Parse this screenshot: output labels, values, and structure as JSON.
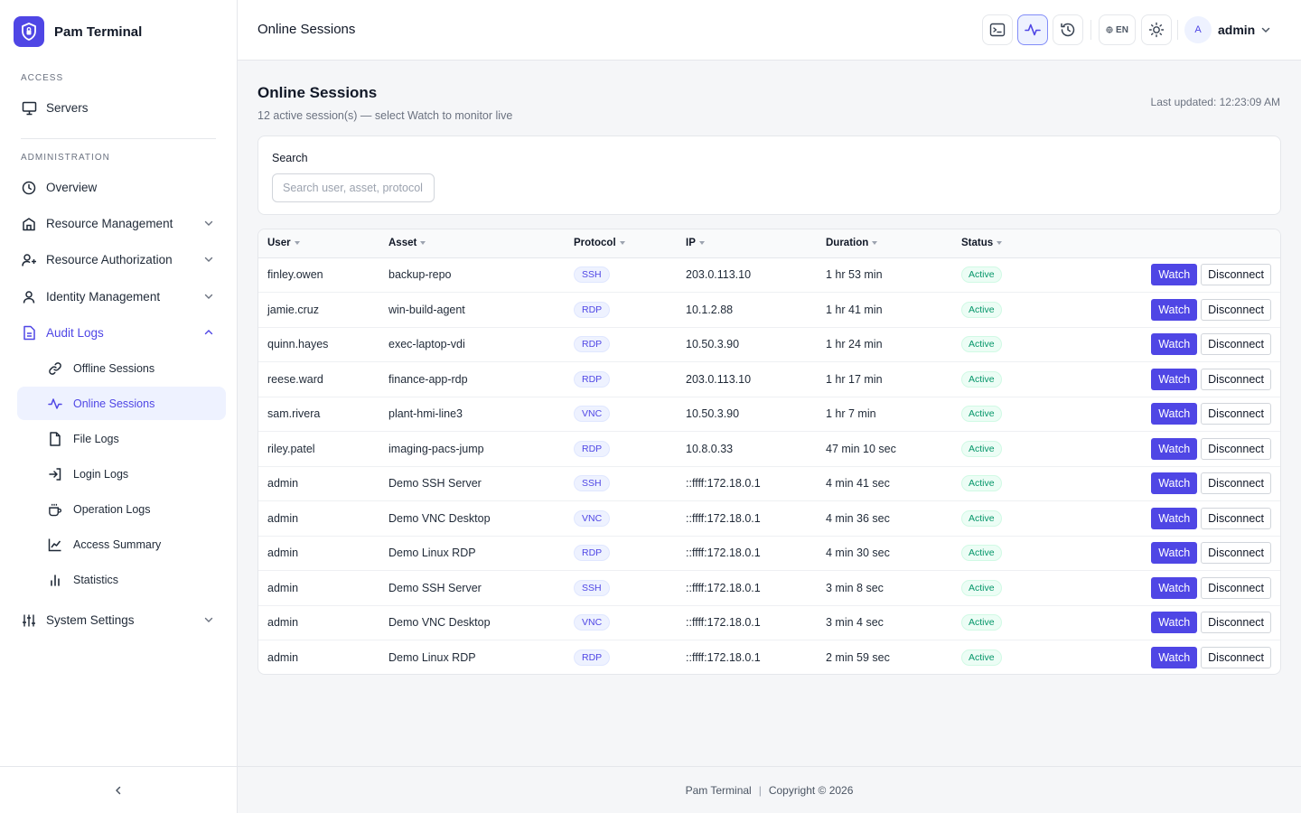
{
  "app": {
    "name": "Pam Terminal",
    "logo_icon": "shield-lock-icon",
    "accent_color": "#4f46e5"
  },
  "sidebar": {
    "sections": {
      "access": "ACCESS",
      "administration": "ADMINISTRATION"
    },
    "items": {
      "servers": "Servers",
      "overview": "Overview",
      "resource_management": "Resource Management",
      "resource_authorization": "Resource Authorization",
      "identity_management": "Identity Management",
      "audit_logs": "Audit Logs",
      "offline_sessions": "Offline Sessions",
      "online_sessions": "Online Sessions",
      "file_logs": "File Logs",
      "login_logs": "Login Logs",
      "operation_logs": "Operation Logs",
      "access_summary": "Access Summary",
      "statistics": "Statistics",
      "system_settings": "System Settings"
    },
    "active_item": "Online Sessions"
  },
  "header": {
    "title": "Online Sessions",
    "language": "EN",
    "user": {
      "avatar_initial": "A",
      "name": "admin"
    }
  },
  "main": {
    "title": "Online Sessions",
    "subtitle": "12 active session(s) — select Watch to monitor live",
    "last_updated": "Last updated: 12:23:09 AM",
    "search": {
      "label": "Search",
      "placeholder": "Search user, asset, protocol",
      "value": ""
    },
    "table": {
      "columns": {
        "user": "User",
        "asset": "Asset",
        "protocol": "Protocol",
        "ip": "IP",
        "duration": "Duration",
        "status": "Status"
      },
      "actions": {
        "watch": "Watch",
        "disconnect": "Disconnect"
      },
      "rows": [
        {
          "user": "finley.owen",
          "asset": "backup-repo",
          "protocol": "SSH",
          "ip": "203.0.113.10",
          "duration": "1 hr 53 min",
          "status": "Active"
        },
        {
          "user": "jamie.cruz",
          "asset": "win-build-agent",
          "protocol": "RDP",
          "ip": "10.1.2.88",
          "duration": "1 hr 41 min",
          "status": "Active"
        },
        {
          "user": "quinn.hayes",
          "asset": "exec-laptop-vdi",
          "protocol": "RDP",
          "ip": "10.50.3.90",
          "duration": "1 hr 24 min",
          "status": "Active"
        },
        {
          "user": "reese.ward",
          "asset": "finance-app-rdp",
          "protocol": "RDP",
          "ip": "203.0.113.10",
          "duration": "1 hr 17 min",
          "status": "Active"
        },
        {
          "user": "sam.rivera",
          "asset": "plant-hmi-line3",
          "protocol": "VNC",
          "ip": "10.50.3.90",
          "duration": "1 hr 7 min",
          "status": "Active"
        },
        {
          "user": "riley.patel",
          "asset": "imaging-pacs-jump",
          "protocol": "RDP",
          "ip": "10.8.0.33",
          "duration": "47 min 10 sec",
          "status": "Active"
        },
        {
          "user": "admin",
          "asset": "Demo SSH Server",
          "protocol": "SSH",
          "ip": "::ffff:172.18.0.1",
          "duration": "4 min 41 sec",
          "status": "Active"
        },
        {
          "user": "admin",
          "asset": "Demo VNC Desktop",
          "protocol": "VNC",
          "ip": "::ffff:172.18.0.1",
          "duration": "4 min 36 sec",
          "status": "Active"
        },
        {
          "user": "admin",
          "asset": "Demo Linux RDP",
          "protocol": "RDP",
          "ip": "::ffff:172.18.0.1",
          "duration": "4 min 30 sec",
          "status": "Active"
        },
        {
          "user": "admin",
          "asset": "Demo SSH Server",
          "protocol": "SSH",
          "ip": "::ffff:172.18.0.1",
          "duration": "3 min 8 sec",
          "status": "Active"
        },
        {
          "user": "admin",
          "asset": "Demo VNC Desktop",
          "protocol": "VNC",
          "ip": "::ffff:172.18.0.1",
          "duration": "3 min 4 sec",
          "status": "Active"
        },
        {
          "user": "admin",
          "asset": "Demo Linux RDP",
          "protocol": "RDP",
          "ip": "::ffff:172.18.0.1",
          "duration": "2 min 59 sec",
          "status": "Active"
        }
      ]
    }
  },
  "footer": {
    "brand": "Pam Terminal",
    "separator": "|",
    "copyright": "Copyright © 2026"
  }
}
